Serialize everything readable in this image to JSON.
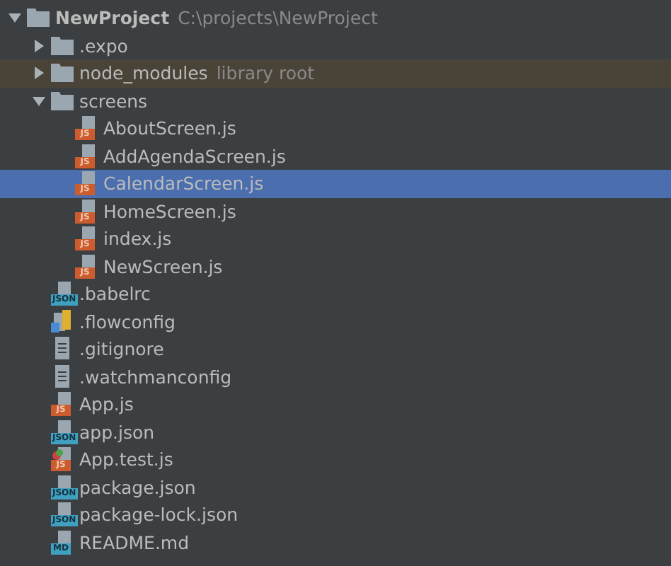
{
  "tree": [
    {
      "label": "NewProject",
      "note": "C:\\projects\\NewProject",
      "kind": "folder",
      "expanded": true,
      "selected": false,
      "highlighted": false,
      "children": [
        {
          "label": ".expo",
          "kind": "folder",
          "expanded": false,
          "selected": false,
          "highlighted": false
        },
        {
          "label": "node_modules",
          "note": "library root",
          "kind": "folder",
          "expanded": false,
          "selected": false,
          "highlighted": true
        },
        {
          "label": "screens",
          "kind": "folder",
          "expanded": true,
          "selected": false,
          "highlighted": false,
          "children": [
            {
              "label": "AboutScreen.js",
              "kind": "js",
              "badge": "JS",
              "selected": false,
              "highlighted": false
            },
            {
              "label": "AddAgendaScreen.js",
              "kind": "js",
              "badge": "JS",
              "selected": false,
              "highlighted": false
            },
            {
              "label": "CalendarScreen.js",
              "kind": "js",
              "badge": "JS",
              "selected": true,
              "highlighted": false
            },
            {
              "label": "HomeScreen.js",
              "kind": "js",
              "badge": "JS",
              "selected": false,
              "highlighted": false
            },
            {
              "label": "index.js",
              "kind": "js",
              "badge": "JS",
              "selected": false,
              "highlighted": false
            },
            {
              "label": "NewScreen.js",
              "kind": "js",
              "badge": "JS",
              "selected": false,
              "highlighted": false
            }
          ]
        },
        {
          "label": ".babelrc",
          "kind": "json",
          "badge": "JSON",
          "selected": false,
          "highlighted": false
        },
        {
          "label": ".flowconfig",
          "kind": "flow",
          "selected": false,
          "highlighted": false
        },
        {
          "label": ".gitignore",
          "kind": "text",
          "selected": false,
          "highlighted": false
        },
        {
          "label": ".watchmanconfig",
          "kind": "text",
          "selected": false,
          "highlighted": false
        },
        {
          "label": "App.js",
          "kind": "js",
          "badge": "JS",
          "selected": false,
          "highlighted": false
        },
        {
          "label": "app.json",
          "kind": "json",
          "badge": "JSON",
          "selected": false,
          "highlighted": false
        },
        {
          "label": "App.test.js",
          "kind": "test",
          "badge": "JS",
          "selected": false,
          "highlighted": false
        },
        {
          "label": "package.json",
          "kind": "json",
          "badge": "JSON",
          "selected": false,
          "highlighted": false
        },
        {
          "label": "package-lock.json",
          "kind": "json",
          "badge": "JSON",
          "selected": false,
          "highlighted": false
        },
        {
          "label": "README.md",
          "kind": "md",
          "badge": "MD",
          "selected": false,
          "highlighted": false
        }
      ]
    }
  ]
}
